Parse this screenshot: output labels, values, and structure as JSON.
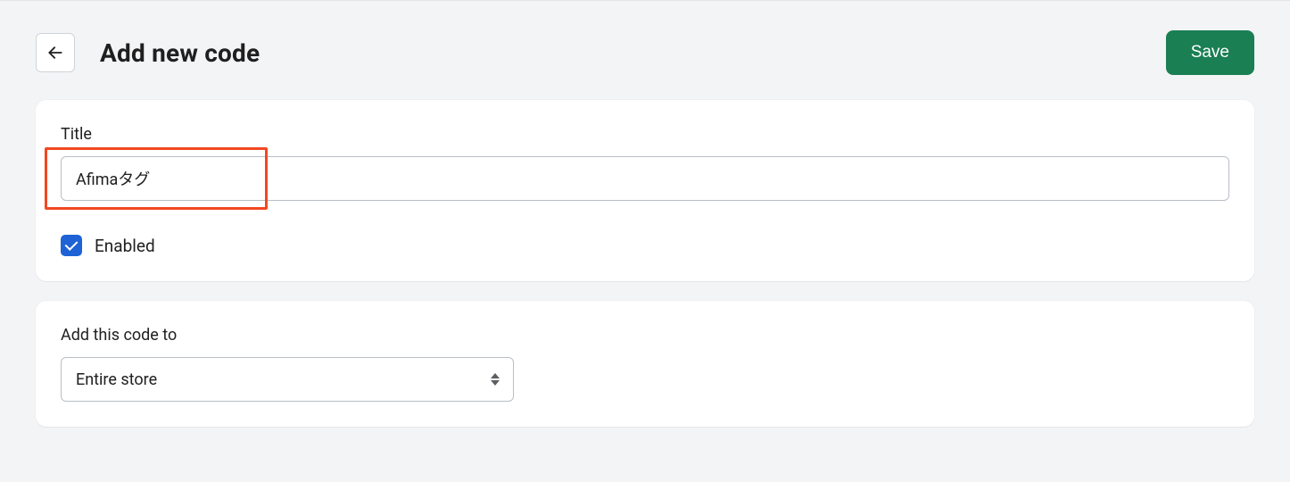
{
  "header": {
    "title": "Add new code",
    "save_label": "Save"
  },
  "titleCard": {
    "label": "Title",
    "value": "Afimaタグ",
    "checkbox_label": "Enabled",
    "checkbox_checked": true
  },
  "targetCard": {
    "label": "Add this code to",
    "selected": "Entire store"
  }
}
